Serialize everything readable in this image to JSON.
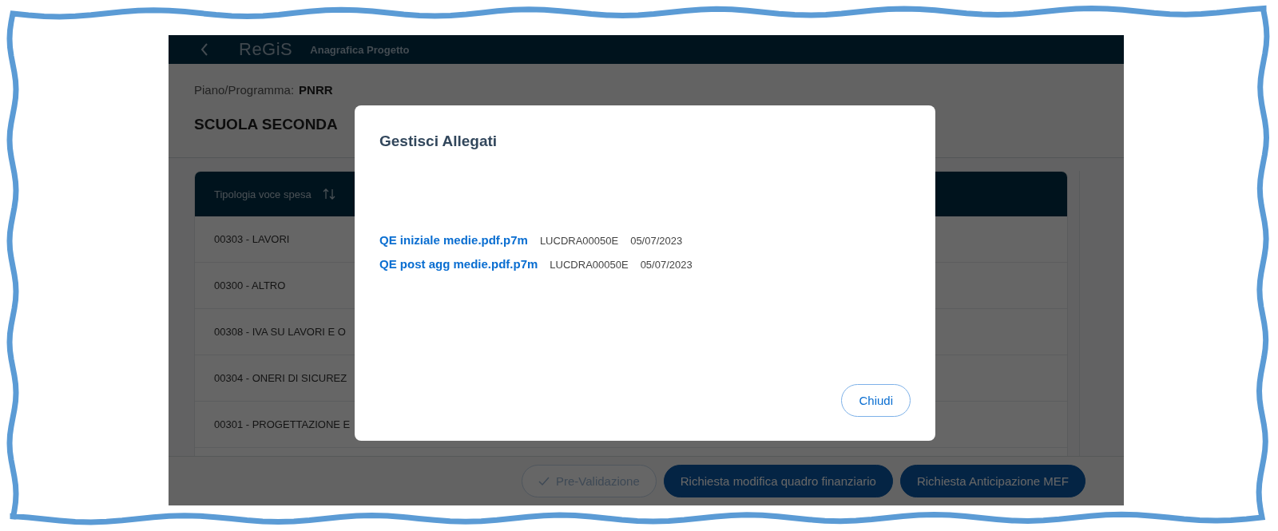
{
  "app_bar": {
    "logo": "ReGiS",
    "title": "Anagrafica Progetto"
  },
  "project": {
    "label": "Piano/Programma:",
    "value": "PNRR",
    "title": "SCUOLA SECONDA"
  },
  "table": {
    "columns": [
      {
        "label": "Tipologia voce spesa",
        "sortable": true
      }
    ],
    "rows": [
      {
        "cells": [
          "00303 - LAVORI"
        ]
      },
      {
        "cells": [
          "00300 - ALTRO"
        ]
      },
      {
        "cells": [
          "00308 - IVA SU LAVORI E O"
        ]
      },
      {
        "cells": [
          "00304 - ONERI DI SICUREZ"
        ]
      },
      {
        "cells": [
          "00301 - PROGETTAZIONE E"
        ]
      }
    ]
  },
  "footer_buttons": [
    {
      "label": "Pre-Validazione",
      "kind": "outline",
      "disabled": true
    },
    {
      "label": "Richiesta modifica quadro finanziario",
      "kind": "primary",
      "disabled": false
    },
    {
      "label": "Richiesta Anticipazione MEF",
      "kind": "primary",
      "disabled": false
    }
  ],
  "dialog": {
    "title": "Gestisci Allegati",
    "attachments": [
      {
        "file": "QE iniziale medie.pdf.p7m",
        "code": "LUCDRA00050E",
        "date": "05/07/2023"
      },
      {
        "file": "QE post agg medie.pdf.p7m",
        "code": "LUCDRA00050E",
        "date": "05/07/2023"
      }
    ],
    "close_button": "Chiudi"
  }
}
